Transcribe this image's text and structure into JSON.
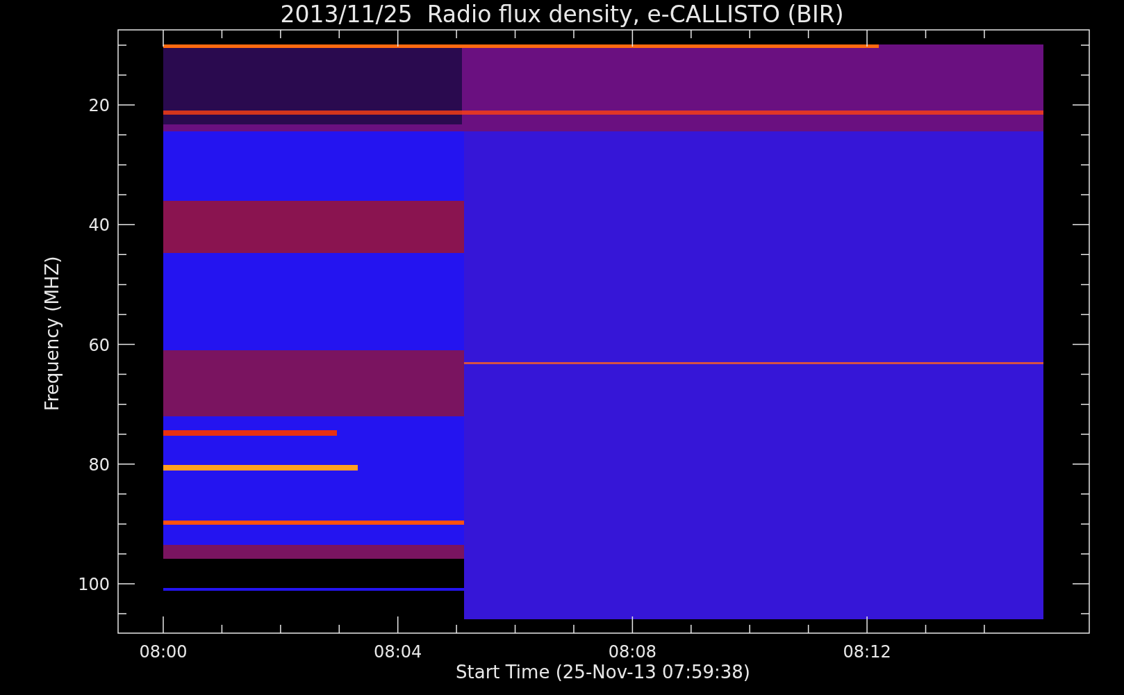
{
  "title": "2013/11/25  Radio flux density, e-CALLISTO (BIR)",
  "y_axis": {
    "label": "Frequency (MHZ)",
    "ticks": [
      "20",
      "40",
      "60",
      "80",
      "100"
    ]
  },
  "x_axis": {
    "label": "Start Time (25-Nov-13 07:59:38)",
    "ticks": [
      "08:00",
      "08:04",
      "08:08",
      "08:12"
    ]
  }
}
